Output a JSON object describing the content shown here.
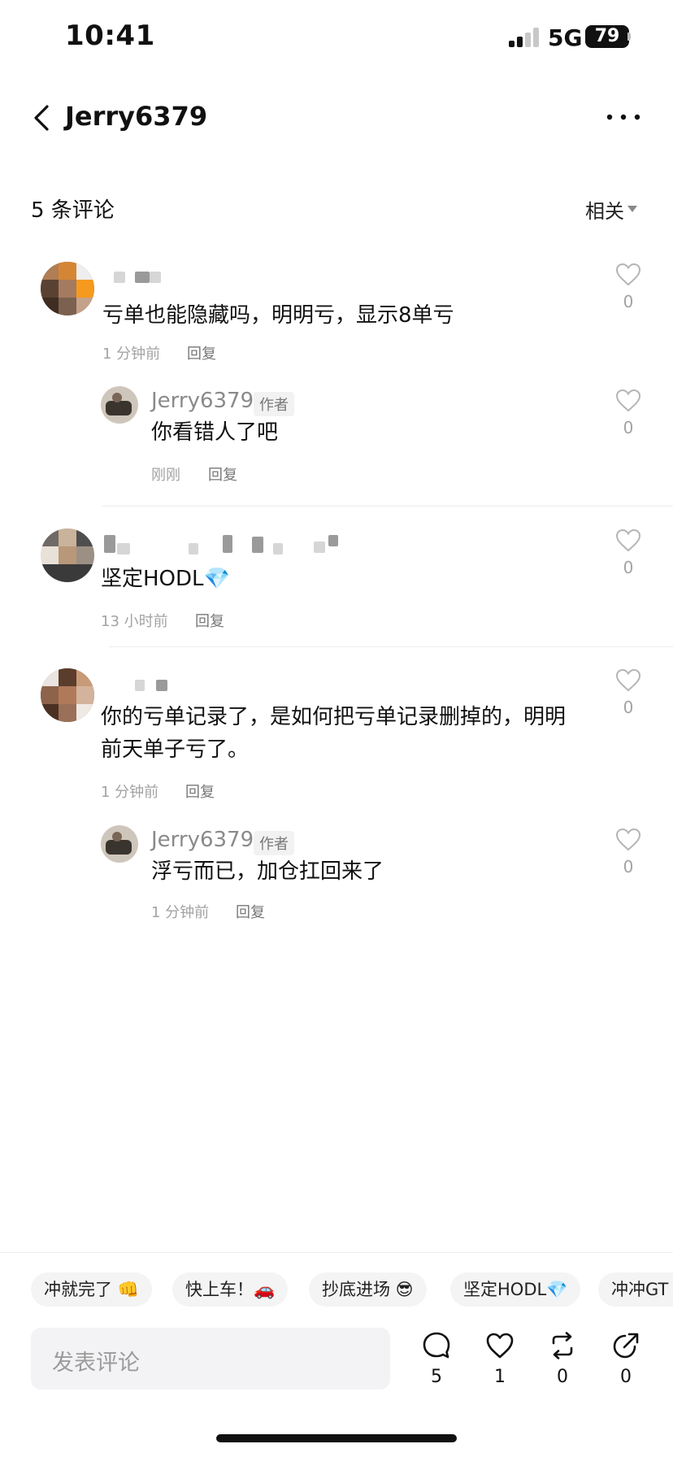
{
  "status_bar": {
    "time": "10:41",
    "network": "5G",
    "battery": "79"
  },
  "header": {
    "title": "Jerry6379"
  },
  "comments_header": {
    "count_label": "5 条评论",
    "sort_label": "相关"
  },
  "comments": [
    {
      "text": "亏单也能隐藏吗，明明亏，显示8单亏",
      "time": "1 分钟前",
      "reply_label": "回复",
      "likes": "0",
      "replies": [
        {
          "username": "Jerry6379",
          "tag": "作者",
          "text": "你看错人了吧",
          "time": "刚刚",
          "reply_label": "回复",
          "likes": "0"
        }
      ]
    },
    {
      "text": "坚定HODL💎",
      "time": "13 小时前",
      "reply_label": "回复",
      "likes": "0"
    },
    {
      "text_line1": "你的亏单记录了，是如何把亏单记录删掉的，明明",
      "text_line2": "前天单子亏了。",
      "time": "1 分钟前",
      "reply_label": "回复",
      "likes": "0",
      "replies": [
        {
          "username": "Jerry6379",
          "tag": "作者",
          "text": "浮亏而已，加仓扛回来了",
          "time": "1 分钟前",
          "reply_label": "回复",
          "likes": "0"
        }
      ]
    }
  ],
  "quick_replies": [
    "冲就完了 👊",
    "快上车！🚗",
    "抄底进场 😎",
    "坚定HODL💎",
    "冲冲GT"
  ],
  "input": {
    "placeholder": "发表评论"
  },
  "actions": {
    "comments": "5",
    "likes": "1",
    "reposts": "0",
    "shares": "0"
  },
  "colors": {
    "avatar_orange": "#f59a1f",
    "avatar_brown": "#6b4a33"
  }
}
